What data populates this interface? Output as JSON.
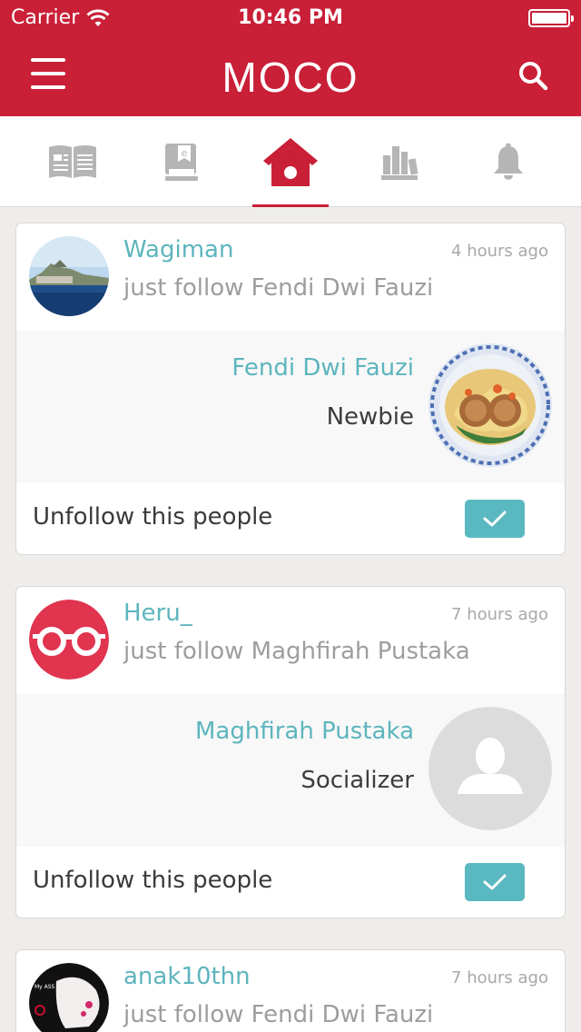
{
  "status_bar": {
    "carrier": "Carrier",
    "time": "10:46 PM"
  },
  "nav": {
    "logo": "MOCO",
    "menu_icon": "hamburger-menu-icon",
    "search_icon": "search-icon"
  },
  "tabs": [
    {
      "icon": "open-book-icon",
      "active": false
    },
    {
      "icon": "ebook-icon",
      "active": false
    },
    {
      "icon": "home-icon",
      "active": true
    },
    {
      "icon": "bookshelf-icon",
      "active": false
    },
    {
      "icon": "bell-icon",
      "active": false
    }
  ],
  "colors": {
    "brand": "#c91f37",
    "accent": "#5db5bd",
    "check_button": "#5ab8c0",
    "background": "#efedeb"
  },
  "feed": [
    {
      "username": "Wagiman",
      "action": "just follow Fendi Dwi Fauzi",
      "time": "4 hours ago",
      "target_name": "Fendi Dwi Fauzi",
      "target_level": "Newbie",
      "unfollow_label": "Unfollow this people",
      "avatar": "landscape-photo",
      "target_avatar": "food-photo"
    },
    {
      "username": "Heru_",
      "action": "just follow Maghfirah Pustaka",
      "time": "7 hours ago",
      "target_name": "Maghfirah Pustaka",
      "target_level": "Socializer",
      "unfollow_label": "Unfollow this people",
      "avatar": "glasses-logo",
      "target_avatar": "default-user-placeholder"
    },
    {
      "username": "anak10thn",
      "action": "just follow Fendi Dwi Fauzi",
      "time": "7 hours ago",
      "avatar": "dark-sticker-photo"
    }
  ]
}
